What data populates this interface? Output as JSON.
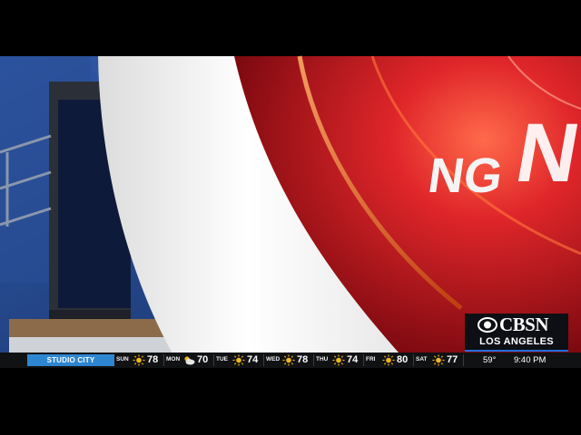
{
  "logo": {
    "brand": "CBSN",
    "market": "LOS ANGELES"
  },
  "graphic": {
    "text": "NG"
  },
  "ticker": {
    "location": "STUDIO CITY",
    "forecast": [
      {
        "day": "SUN",
        "icon": "sun-icon",
        "temp": "78"
      },
      {
        "day": "MON",
        "icon": "partly-cloudy-icon",
        "temp": "70"
      },
      {
        "day": "TUE",
        "icon": "sun-icon",
        "temp": "74"
      },
      {
        "day": "WED",
        "icon": "sun-icon",
        "temp": "78"
      },
      {
        "day": "THU",
        "icon": "sun-icon",
        "temp": "74"
      },
      {
        "day": "FRI",
        "icon": "sun-icon",
        "temp": "80"
      },
      {
        "day": "SAT",
        "icon": "sun-icon",
        "temp": "77"
      }
    ],
    "current_temp": "59°",
    "time": "9:40 PM"
  },
  "colors": {
    "accent_blue": "#2f86d0",
    "graphic_red": "#c81b21",
    "ticker_bg": "#111214",
    "sun": "#f2b51b"
  }
}
